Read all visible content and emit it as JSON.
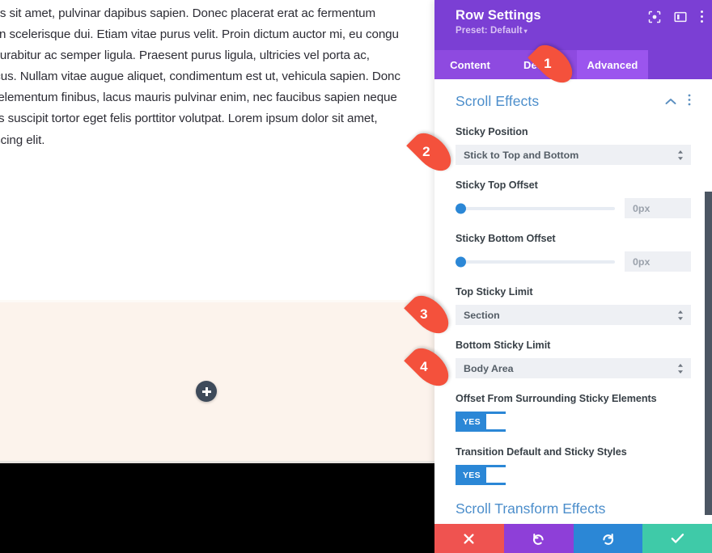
{
  "canvas": {
    "paragraph_lines": [
      "nec lectus sit amet, pulvinar dapibus sapien. Donec placerat erat ac fermentum",
      "n. Nunc in scelerisque dui. Etiam vitae purus velit. Proin dictum auctor mi, eu congu",
      "pus et. Curabitur ac semper ligula. Praesent purus ligula, ultricies vel porta ac,",
      "um et lacus. Nullam vitae augue aliquet, condimentum est ut, vehicula sapien. Donc",
      ", sem et elementum finibus, lacus mauris pulvinar enim, nec faucibus sapien neque",
      ". Vivamus suscipit tortor eget felis porttitor volutpat. Lorem ipsum dolor sit amet,",
      "tur adipiscing elit."
    ],
    "add_button_icon": "plus-icon",
    "cream_color": "#fcf3ec",
    "black_color": "#000000"
  },
  "panel": {
    "title": "Row Settings",
    "preset_label": "Preset: Default",
    "preset_caret": "▾",
    "header_color": "#7b3fd4",
    "header_icons": [
      {
        "name": "focus-target-icon"
      },
      {
        "name": "panel-layout-icon"
      },
      {
        "name": "more-options-icon"
      }
    ],
    "tabs": [
      {
        "label": "Content",
        "active": false
      },
      {
        "label": "Design",
        "active": false
      },
      {
        "label": "Advanced",
        "active": true
      }
    ],
    "section": {
      "title": "Scroll Effects",
      "title_color": "#4c8ecb",
      "collapse_icon": "chevron-up-icon",
      "menu_icon": "more-options-icon"
    },
    "fields": {
      "sticky_position": {
        "label": "Sticky Position",
        "value": "Stick to Top and Bottom"
      },
      "sticky_top_offset": {
        "label": "Sticky Top Offset",
        "placeholder": "0px",
        "slider_percent": 0
      },
      "sticky_bottom_offset": {
        "label": "Sticky Bottom Offset",
        "placeholder": "0px",
        "slider_percent": 0
      },
      "top_sticky_limit": {
        "label": "Top Sticky Limit",
        "value": "Section"
      },
      "bottom_sticky_limit": {
        "label": "Bottom Sticky Limit",
        "value": "Body Area"
      },
      "offset_from_surrounding": {
        "label": "Offset From Surrounding Sticky Elements",
        "toggle_value": "YES"
      },
      "transition_styles": {
        "label": "Transition Default and Sticky Styles",
        "toggle_value": "YES"
      }
    },
    "next_section_title": "Scroll Transform Effects",
    "footer_buttons": [
      {
        "name": "cancel-button",
        "icon": "close-icon",
        "color": "#ef5350"
      },
      {
        "name": "undo-button",
        "icon": "undo-icon",
        "color": "#8e3fd8"
      },
      {
        "name": "redo-button",
        "icon": "redo-icon",
        "color": "#2b87d6"
      },
      {
        "name": "save-button",
        "icon": "check-icon",
        "color": "#3fcaa8"
      }
    ]
  },
  "callouts": [
    {
      "number": "1"
    },
    {
      "number": "2"
    },
    {
      "number": "3"
    },
    {
      "number": "4"
    }
  ]
}
